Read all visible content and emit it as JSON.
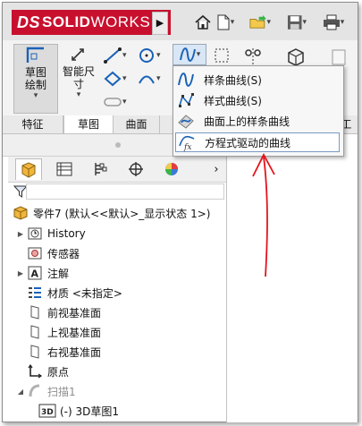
{
  "app": {
    "logo_ds": "DS",
    "logo_brand": "SOLID",
    "logo_works": "WORKS"
  },
  "toolbar_icons": [
    "home-icon",
    "new-document-icon",
    "open-folder-icon",
    "save-icon",
    "print-icon"
  ],
  "ribbon": {
    "sketch_label": "草图绘制",
    "smart_dim_label": "智能尺寸",
    "tabs": [
      {
        "label": "特征"
      },
      {
        "label": "草图"
      },
      {
        "label": "曲面"
      },
      {
        "label": "工"
      }
    ]
  },
  "spline_menu": {
    "items": [
      {
        "label": "样条曲线(S)",
        "icon": "spline-icon"
      },
      {
        "label": "样式曲线(S)",
        "icon": "style-spline-icon"
      },
      {
        "label": "曲面上的样条曲线",
        "icon": "spline-on-surface-icon"
      },
      {
        "label": "方程式驱动的曲线",
        "icon": "equation-curve-icon",
        "highlighted": true
      }
    ]
  },
  "manager_tabs": [
    "feature-manager-icon",
    "property-manager-icon",
    "configuration-manager-icon",
    "dimxpert-icon",
    "display-manager-icon"
  ],
  "tree": {
    "root": "零件7 (默认<<默认>_显示状态 1>)",
    "items": [
      {
        "label": "History",
        "expandable": true
      },
      {
        "label": "传感器",
        "expandable": false
      },
      {
        "label": "注解",
        "expandable": true
      },
      {
        "label": "材质 <未指定>",
        "expandable": false
      },
      {
        "label": "前视基准面",
        "expandable": false
      },
      {
        "label": "上视基准面",
        "expandable": false
      },
      {
        "label": "右视基准面",
        "expandable": false
      },
      {
        "label": "原点",
        "expandable": false
      },
      {
        "label": "扫描1",
        "expandable": true,
        "dimmed": true
      },
      {
        "label": "(-) 3D草图1",
        "expandable": false
      }
    ]
  },
  "annotation_color": "#e3141b"
}
